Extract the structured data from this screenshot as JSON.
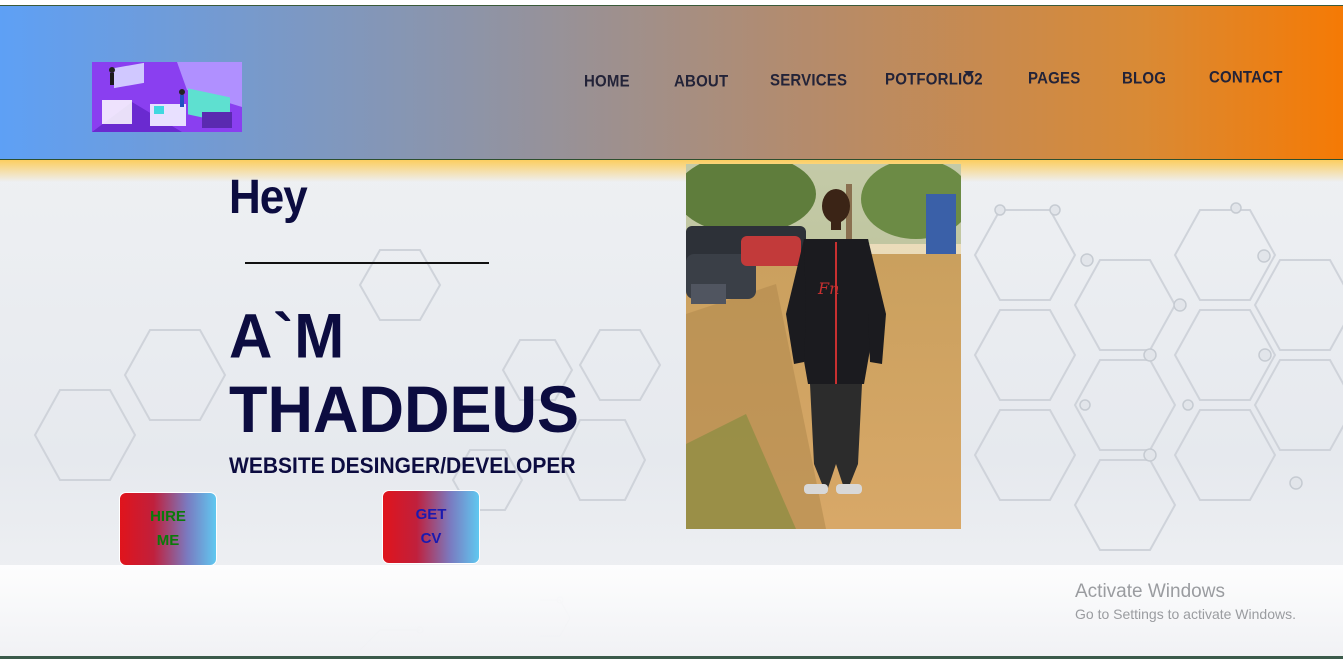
{
  "nav": {
    "items": [
      {
        "label": "HOME"
      },
      {
        "label": "ABOUT"
      },
      {
        "label": "SERVICES"
      },
      {
        "label": "POTFORLIO2"
      },
      {
        "label": "PAGES"
      },
      {
        "label": "BLOG"
      },
      {
        "label": "CONTACT"
      }
    ]
  },
  "hero": {
    "greeting": "Hey",
    "name_line1": "A`M",
    "name_line2": "THADDEUS",
    "role": "WEBSITE  DESINGER/DEVELOPER",
    "hire_button": "HIRE ME",
    "cv_button": "GET CV"
  },
  "watermark": {
    "title": "Activate Windows",
    "subtitle": "Go to Settings to activate Windows."
  },
  "colors": {
    "nav_gradient_start": "#5ea0f5",
    "nav_gradient_end": "#f57a05",
    "heading": "#0c0c40",
    "button_red": "#e0141c",
    "button_blue": "#60c8f0"
  }
}
